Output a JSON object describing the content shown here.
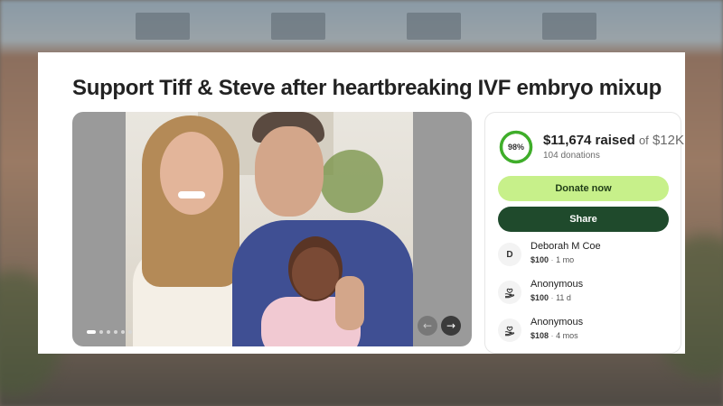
{
  "campaign": {
    "title": "Support Tiff & Steve after heartbreaking IVF embryo mixup"
  },
  "gallery": {
    "slide_count": 6,
    "active_slide": 1,
    "prev_icon": "arrow-left-icon",
    "next_icon": "arrow-right-icon"
  },
  "progress": {
    "percent": 98,
    "percent_label": "98%",
    "raised": "$11,674 raised",
    "of": "of",
    "goal": "$12K",
    "donations": "104 donations",
    "colors": {
      "ring": "#3fae2a",
      "track": "#e8e8e8"
    }
  },
  "actions": {
    "donate_label": "Donate now",
    "share_label": "Share",
    "colors": {
      "donate_bg": "#c7f08a",
      "share_bg": "#1f4a2c"
    }
  },
  "donors": [
    {
      "avatar": "D",
      "avatar_icon": null,
      "name": "Deborah M Coe",
      "amount": "$100",
      "separator": "·",
      "time": "1 mo"
    },
    {
      "avatar": null,
      "avatar_icon": "heart-hand-icon",
      "name": "Anonymous",
      "amount": "$100",
      "separator": "·",
      "time": "11 d"
    },
    {
      "avatar": null,
      "avatar_icon": "heart-hand-icon",
      "name": "Anonymous",
      "amount": "$108",
      "separator": "·",
      "time": "4 mos"
    }
  ]
}
